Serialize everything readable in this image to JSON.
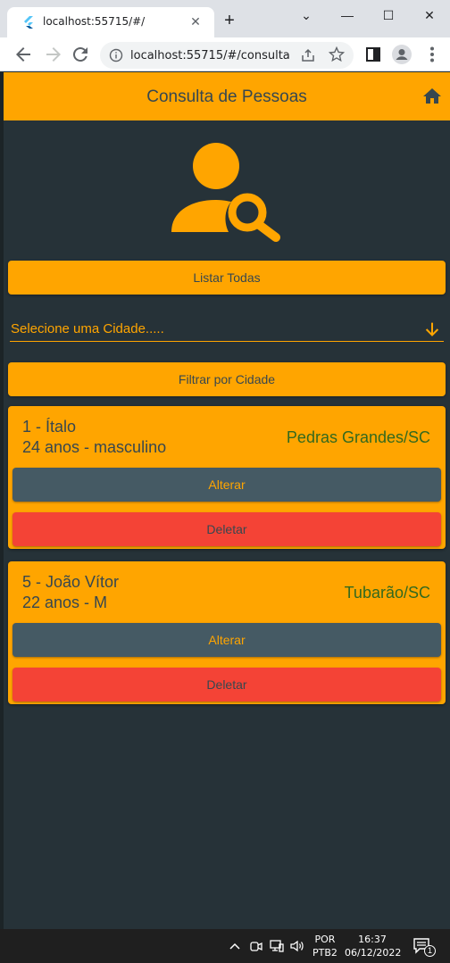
{
  "browser": {
    "tab_title": "localhost:55715/#/",
    "close_glyph": "✕",
    "newtab_glyph": "+",
    "address": "localhost:55715/#/consulta",
    "window_controls": {
      "dropdown": "⌄",
      "minimize": "—",
      "maximize": "☐",
      "close": "✕"
    }
  },
  "app": {
    "title": "Consulta de Pessoas",
    "list_all_label": "Listar Todas",
    "city_select_placeholder": "Selecione uma Cidade.....",
    "filter_label": "Filtrar por Cidade",
    "people": [
      {
        "line1": "1 - Ítalo",
        "line2": "24 anos - masculino",
        "city": "Pedras Grandes/SC",
        "alter_label": "Alterar",
        "delete_label": "Deletar"
      },
      {
        "line1": "5 - João Vítor",
        "line2": "22 anos - M",
        "city": "Tubarão/SC",
        "alter_label": "Alterar",
        "delete_label": "Deletar"
      }
    ],
    "colors": {
      "primary": "#ffa500",
      "background": "#263238",
      "text": "#37474f",
      "city_text": "#33691e",
      "alter_bg": "#455a64",
      "delete_bg": "#f44336"
    }
  },
  "taskbar": {
    "lang_top": "POR",
    "lang_bottom": "PTB2",
    "time": "16:37",
    "date": "06/12/2022",
    "notification_count": "1"
  }
}
